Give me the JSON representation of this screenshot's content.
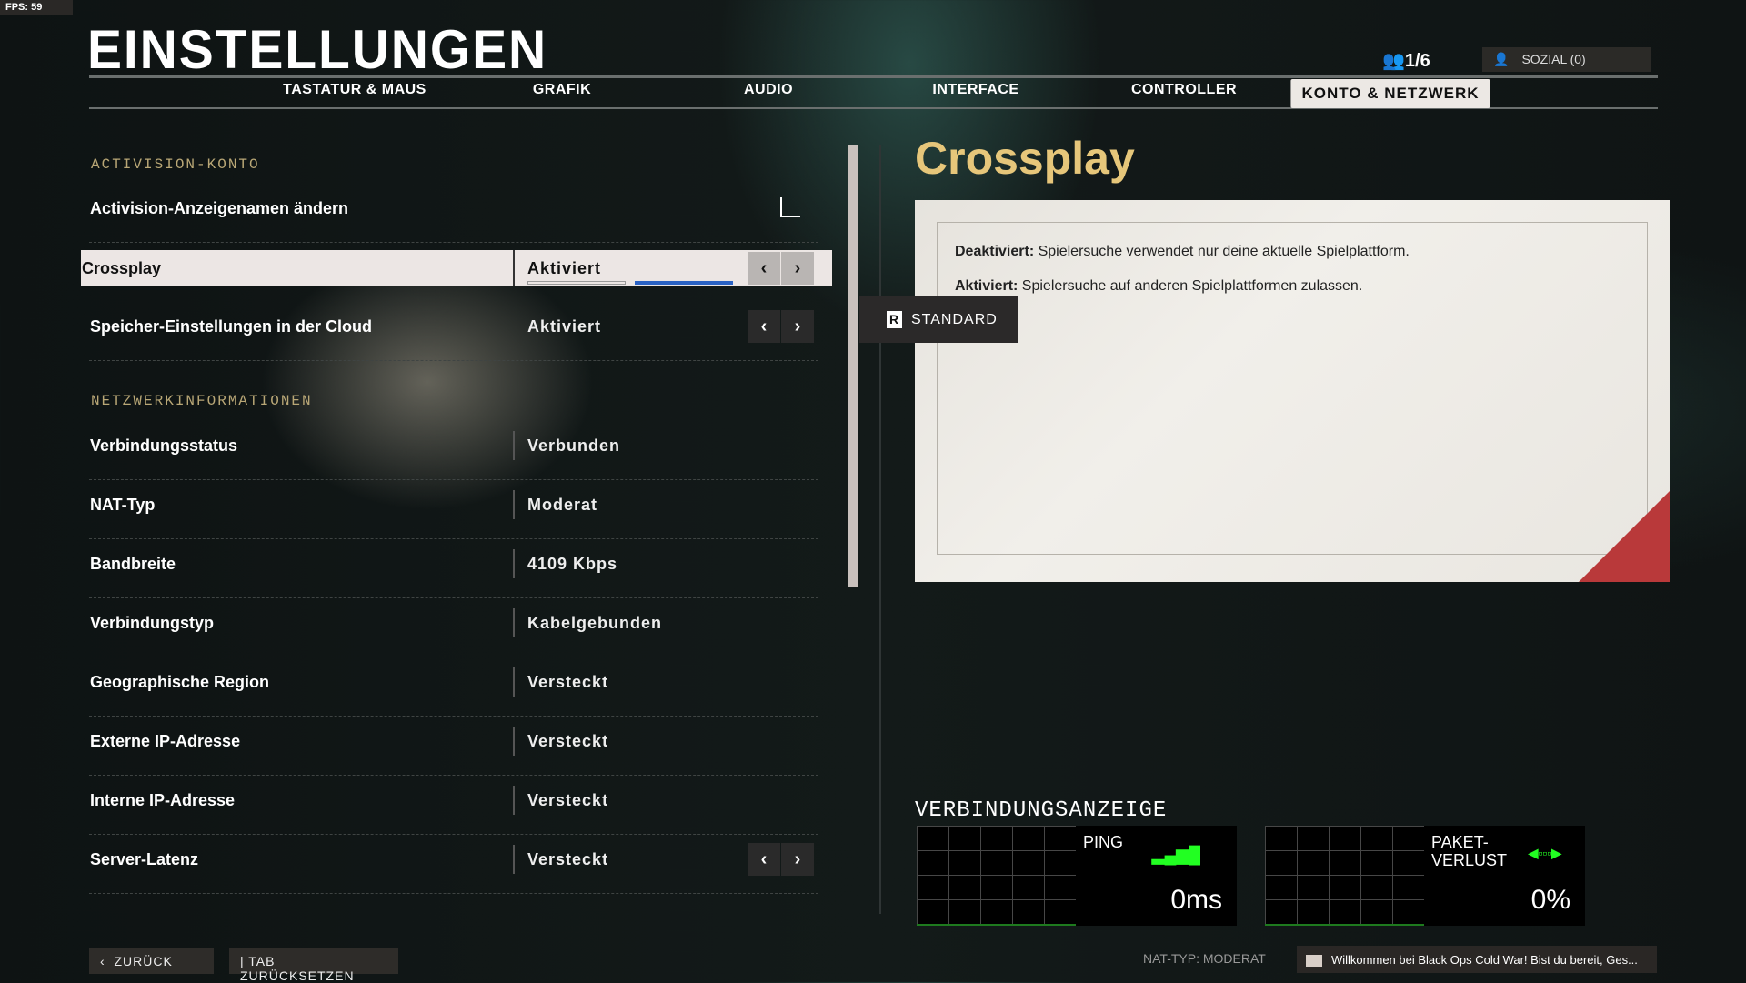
{
  "fps": "FPS: 59",
  "header": {
    "title": "EINSTELLUNGEN",
    "party": "1/6",
    "social": "SOZIAL (0)"
  },
  "tabs": [
    {
      "label": "TASTATUR & MAUS"
    },
    {
      "label": "GRAFIK"
    },
    {
      "label": "AUDIO"
    },
    {
      "label": "INTERFACE"
    },
    {
      "label": "CONTROLLER"
    },
    {
      "label": "KONTO & NETZWERK",
      "active": true
    }
  ],
  "sections": {
    "account": "ACTIVISION-KONTO",
    "network": "NETZWERKINFORMATIONEN"
  },
  "rows": [
    {
      "label": "Activision-Anzeigenamen ändern",
      "value": "",
      "link": true
    },
    {
      "label": "Crossplay",
      "value": "Aktiviert",
      "arrows": true,
      "selected": true
    },
    {
      "label": "Speicher-Einstellungen in der Cloud",
      "value": "Aktiviert",
      "arrows": true
    },
    {
      "label": "Verbindungsstatus",
      "value": "Verbunden"
    },
    {
      "label": "NAT-Typ",
      "value": "Moderat"
    },
    {
      "label": "Bandbreite",
      "value": "4109 Kbps"
    },
    {
      "label": "Verbindungstyp",
      "value": "Kabelgebunden"
    },
    {
      "label": "Geographische Region",
      "value": "Versteckt"
    },
    {
      "label": "Externe IP-Adresse",
      "value": "Versteckt"
    },
    {
      "label": "Interne IP-Adresse",
      "value": "Versteckt"
    },
    {
      "label": "Server-Latenz",
      "value": "Versteckt",
      "arrows": true
    }
  ],
  "detail": {
    "title": "Crossplay",
    "line1_bold": "Deaktiviert:",
    "line1": " Spielersuche verwendet nur deine aktuelle Spielplattform.",
    "line2_bold": "Aktiviert:",
    "line2": " Spielersuche auf anderen Spielplattformen zulassen.",
    "default_key": "R",
    "default_label": "STANDARD"
  },
  "meter": {
    "title": "VERBINDUNGSANZEIGE",
    "ping_label": "PING",
    "ping_value": "0ms",
    "loss_label": "PAKET-\nVERLUST",
    "loss_value": "0%"
  },
  "footer": {
    "back": "ZURÜCK",
    "reset": "| TAB ZURÜCKSETZEN",
    "nat": "NAT-TYP: MODERAT",
    "chat": "Willkommen bei Black Ops Cold War! Bist du bereit, Ges..."
  },
  "colors": {
    "accent": "#e6c67a",
    "selected_bg": "#ece6e4",
    "signal": "#22ff22",
    "corner": "#b9393a"
  }
}
